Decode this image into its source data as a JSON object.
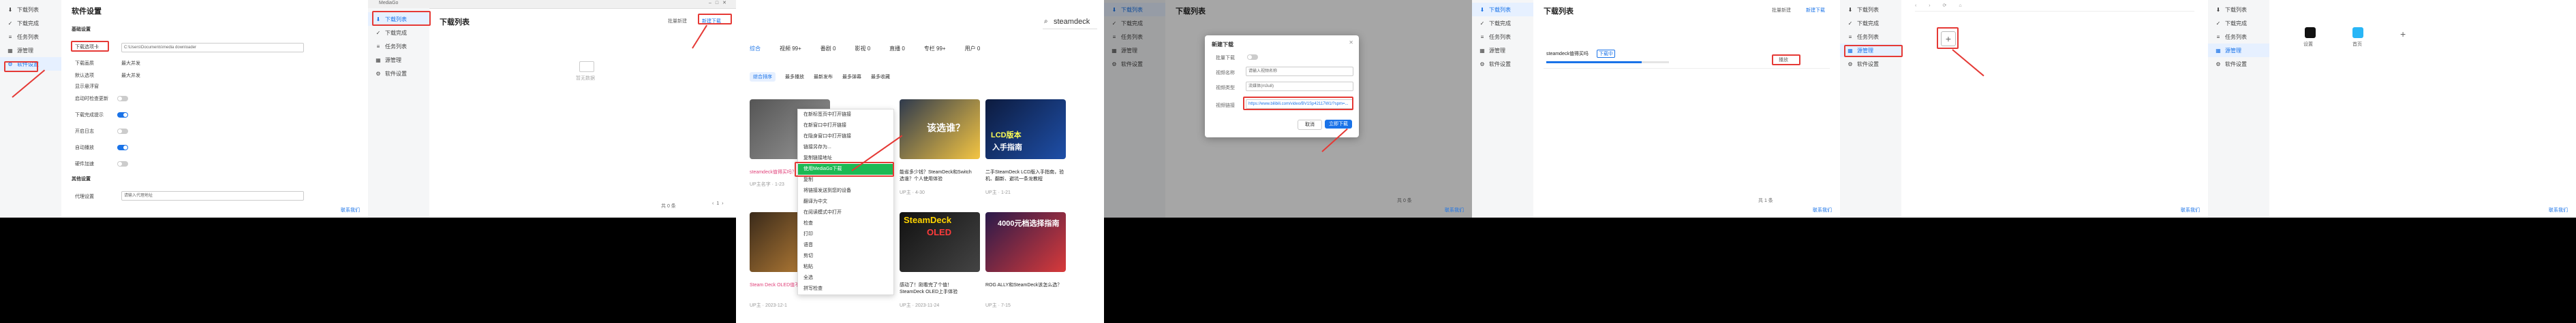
{
  "nav": {
    "download_list": "下载列表",
    "download_done": "下载完成",
    "queue": "任务列表",
    "source": "源管理",
    "settings": "软件设置"
  },
  "p1": {
    "title": "软件设置",
    "section_basic": "基础设置",
    "tab_download": "下载选项卡",
    "placeholder_path": "C:\\Users\\Documents\\media downloader",
    "label_quality": "下载画质",
    "label_threads": "最大并发",
    "label_default": "默认选项",
    "label_a": "启动时检查更新",
    "label_b": "下载完成提示",
    "label_c": "显示悬浮窗",
    "label_d": "开启日志",
    "label_e": "自动播放",
    "label_f": "硬件加速",
    "section_other": "其他设置",
    "label_proxy": "代理设置",
    "placeholder_proxy": "请输入代理地址",
    "footer": "联系我们"
  },
  "p2": {
    "win_title": "MediaGo",
    "title": "下载列表",
    "btn_batch": "批量新建",
    "btn_new": "新建下载",
    "empty": "暂无数据",
    "pager": "共 0 条",
    "footer": "联系我们"
  },
  "p3": {
    "search_value": "steamdeck",
    "tabs": [
      "综合",
      "视频 99+",
      "番剧 0",
      "影视 0",
      "直播 0",
      "专栏 99+",
      "用户 0"
    ],
    "filters": [
      "综合排序",
      "最多播放",
      "最新发布",
      "最多弹幕",
      "最多收藏"
    ],
    "menu": [
      "在新标签页中打开链接",
      "在新窗口中打开链接",
      "在隐身窗口中打开链接",
      "链接另存为...",
      "复制链接地址",
      "使用MediaGo下载",
      "复制",
      "将链接发送到您的设备",
      "翻译为中文",
      "在阅读模式中打开",
      "检查",
      "打印",
      "语音",
      "剪切",
      "粘贴",
      "全选",
      "拼写检查"
    ],
    "cards": [
      {
        "title": "steamdeck值得买吗？",
        "meta": "UP主名字 · 1-23"
      },
      {
        "title": "能省多少钱？SteamDeck和Switch选谁？个人使用体验",
        "meta": "UP主 · 4-30"
      },
      {
        "title": "二手SteamDeck LCD版入手指南，验机、翻新、避坑一条龙教程",
        "meta": "UP主 · 1-21"
      },
      {
        "title": "Steam Deck OLED值不值得买",
        "meta": "UP主 · 2023-12-1"
      },
      {
        "title": "感动了！刚看完了个值！SteamDeck OLED上手体验",
        "meta": "UP主 · 2023-11-24"
      },
      {
        "title": "ROG ALLY和SteamDeck该怎么选？",
        "meta": "UP主 · 7-15"
      }
    ],
    "thumb_texts": [
      "该选谁？",
      "LCD版本",
      "入手指南",
      "SteamDeck",
      "OLED",
      "4000元档选择指南"
    ]
  },
  "p4": {
    "dialog_title": "新建下载",
    "label_batch": "批量下载",
    "label_name": "视频名称",
    "label_type": "视频类型",
    "label_url": "视频链接",
    "name_value": "请输入视频名称",
    "type_value": "流媒体(m3u8)",
    "url_value": "https://www.bilibili.com/video/BV1Sp42117W1/?spm=...",
    "btn_cancel": "取消",
    "btn_ok": "立即下载",
    "pager": "共 0 条",
    "footer": "联系我们"
  },
  "p5": {
    "title": "下载列表",
    "btn_batch": "批量新建",
    "btn_new": "新建下载",
    "item_title": "steamdeck值得买吗",
    "item_tag": "下载中",
    "progress": 0.78,
    "btn_play": "播放",
    "pager": "共 1 条",
    "footer": "联系我们"
  },
  "p6": {
    "add_icon": "+",
    "footer": "联系我们"
  },
  "p7": {
    "app_1": "设置",
    "app_2": "首页",
    "footer": "联系我们"
  }
}
